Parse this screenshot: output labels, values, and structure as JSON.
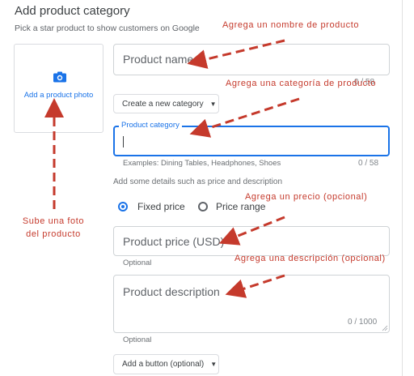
{
  "header": {
    "title": "Add product category",
    "subtitle": "Pick a star product to show customers on Google"
  },
  "photo": {
    "label": "Add a product photo",
    "icon": "camera-icon"
  },
  "product_name": {
    "placeholder": "Product name",
    "counter": "0 / 58"
  },
  "create_category_button": "Create a new category",
  "product_category": {
    "label": "Product category",
    "value": "",
    "hint": "Examples: Dining Tables, Headphones, Shoes",
    "counter": "0 / 58"
  },
  "details_note": "Add some details such as price and description",
  "price_type": {
    "options": [
      "Fixed price",
      "Price range"
    ],
    "selected": "Fixed price"
  },
  "product_price": {
    "placeholder": "Product price (USD)",
    "helper": "Optional"
  },
  "product_description": {
    "placeholder": "Product description",
    "counter": "0 / 1000",
    "helper": "Optional"
  },
  "add_button": "Add a button (optional)",
  "annotations": {
    "name": "Agrega un nombre de producto",
    "category": "Agrega una categoría de producto",
    "price": "Agrega un precio (opcional)",
    "description": "Agrega una descripción (opcional)",
    "photo_line1": "Sube una foto",
    "photo_line2": "del producto"
  },
  "colors": {
    "accent": "#1a73e8",
    "annotation": "#c53a2c"
  }
}
